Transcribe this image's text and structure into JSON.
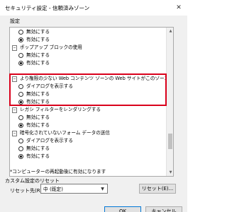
{
  "window": {
    "title": "セキュリティ設定 - 信頼済みゾーン",
    "close_glyph": "✕"
  },
  "settings": {
    "label": "設定",
    "items": [
      {
        "kind": "radio",
        "label": "無効にする",
        "checked": false
      },
      {
        "kind": "radio",
        "label": "有効にする",
        "checked": true
      },
      {
        "kind": "heading",
        "label": "ポップアップ ブロックの使用"
      },
      {
        "kind": "radio",
        "label": "無効にする",
        "checked": false
      },
      {
        "kind": "radio",
        "label": "有効にする",
        "checked": true
      },
      {
        "kind": "heading",
        "label": "より権限の少ない Web コンテンツ ゾーンの Web サイトがこのゾーンに移動できる"
      },
      {
        "kind": "radio",
        "label": "ダイアログを表示する",
        "checked": false
      },
      {
        "kind": "radio",
        "label": "無効にする",
        "checked": false
      },
      {
        "kind": "radio",
        "label": "有効にする",
        "checked": true
      },
      {
        "kind": "heading",
        "label": "レガシ フィルターをレンダリングする"
      },
      {
        "kind": "radio",
        "label": "無効にする",
        "checked": false
      },
      {
        "kind": "radio",
        "label": "有効にする",
        "checked": true
      },
      {
        "kind": "heading",
        "label": "暗号化されていないフォーム データの送信"
      },
      {
        "kind": "radio",
        "label": "ダイアログを表示する",
        "checked": false
      },
      {
        "kind": "radio",
        "label": "無効にする",
        "checked": false
      },
      {
        "kind": "radio",
        "label": "有効にする",
        "checked": true
      }
    ],
    "note": "*コンピューターの再起動後に有効になります",
    "scroll_up": "▲",
    "scroll_down": "▼"
  },
  "reset": {
    "group_title": "カスタム設定のリセット",
    "label": "リセット先(R):",
    "selected": "中 (既定)",
    "dropdown_glyph": "▼",
    "reset_button": "リセット(E)..."
  },
  "footer": {
    "ok": "OK",
    "cancel": "キャンセル"
  },
  "colors": {
    "highlight": "#d9001b"
  }
}
